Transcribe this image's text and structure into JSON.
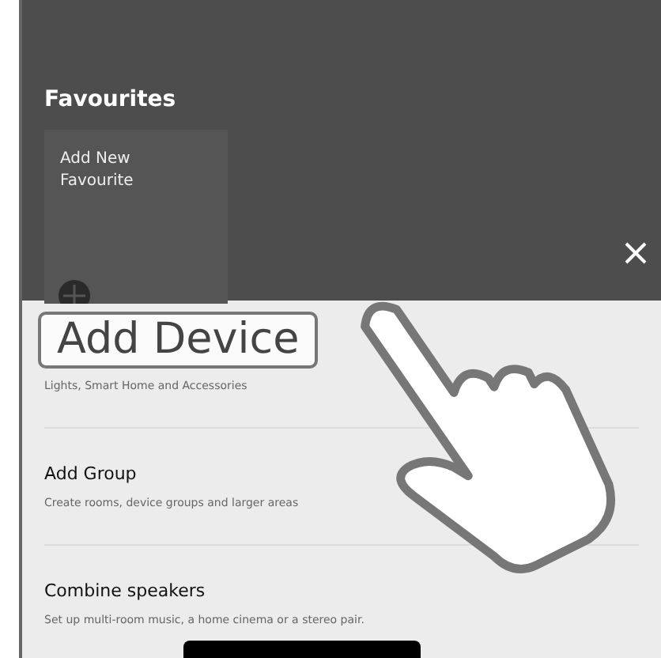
{
  "header": {
    "title": "Favourites",
    "card": {
      "label": "Add New Favourite"
    }
  },
  "sheet": {
    "items": [
      {
        "subtitle": "Lights, Smart Home and Accessories"
      },
      {
        "title": "Add Group",
        "subtitle": "Create rooms, device groups and larger areas"
      },
      {
        "title": "Combine speakers",
        "subtitle": "Set up multi-room music, a home cinema or a stereo pair."
      }
    ]
  },
  "callout": {
    "text": "Add Device"
  }
}
